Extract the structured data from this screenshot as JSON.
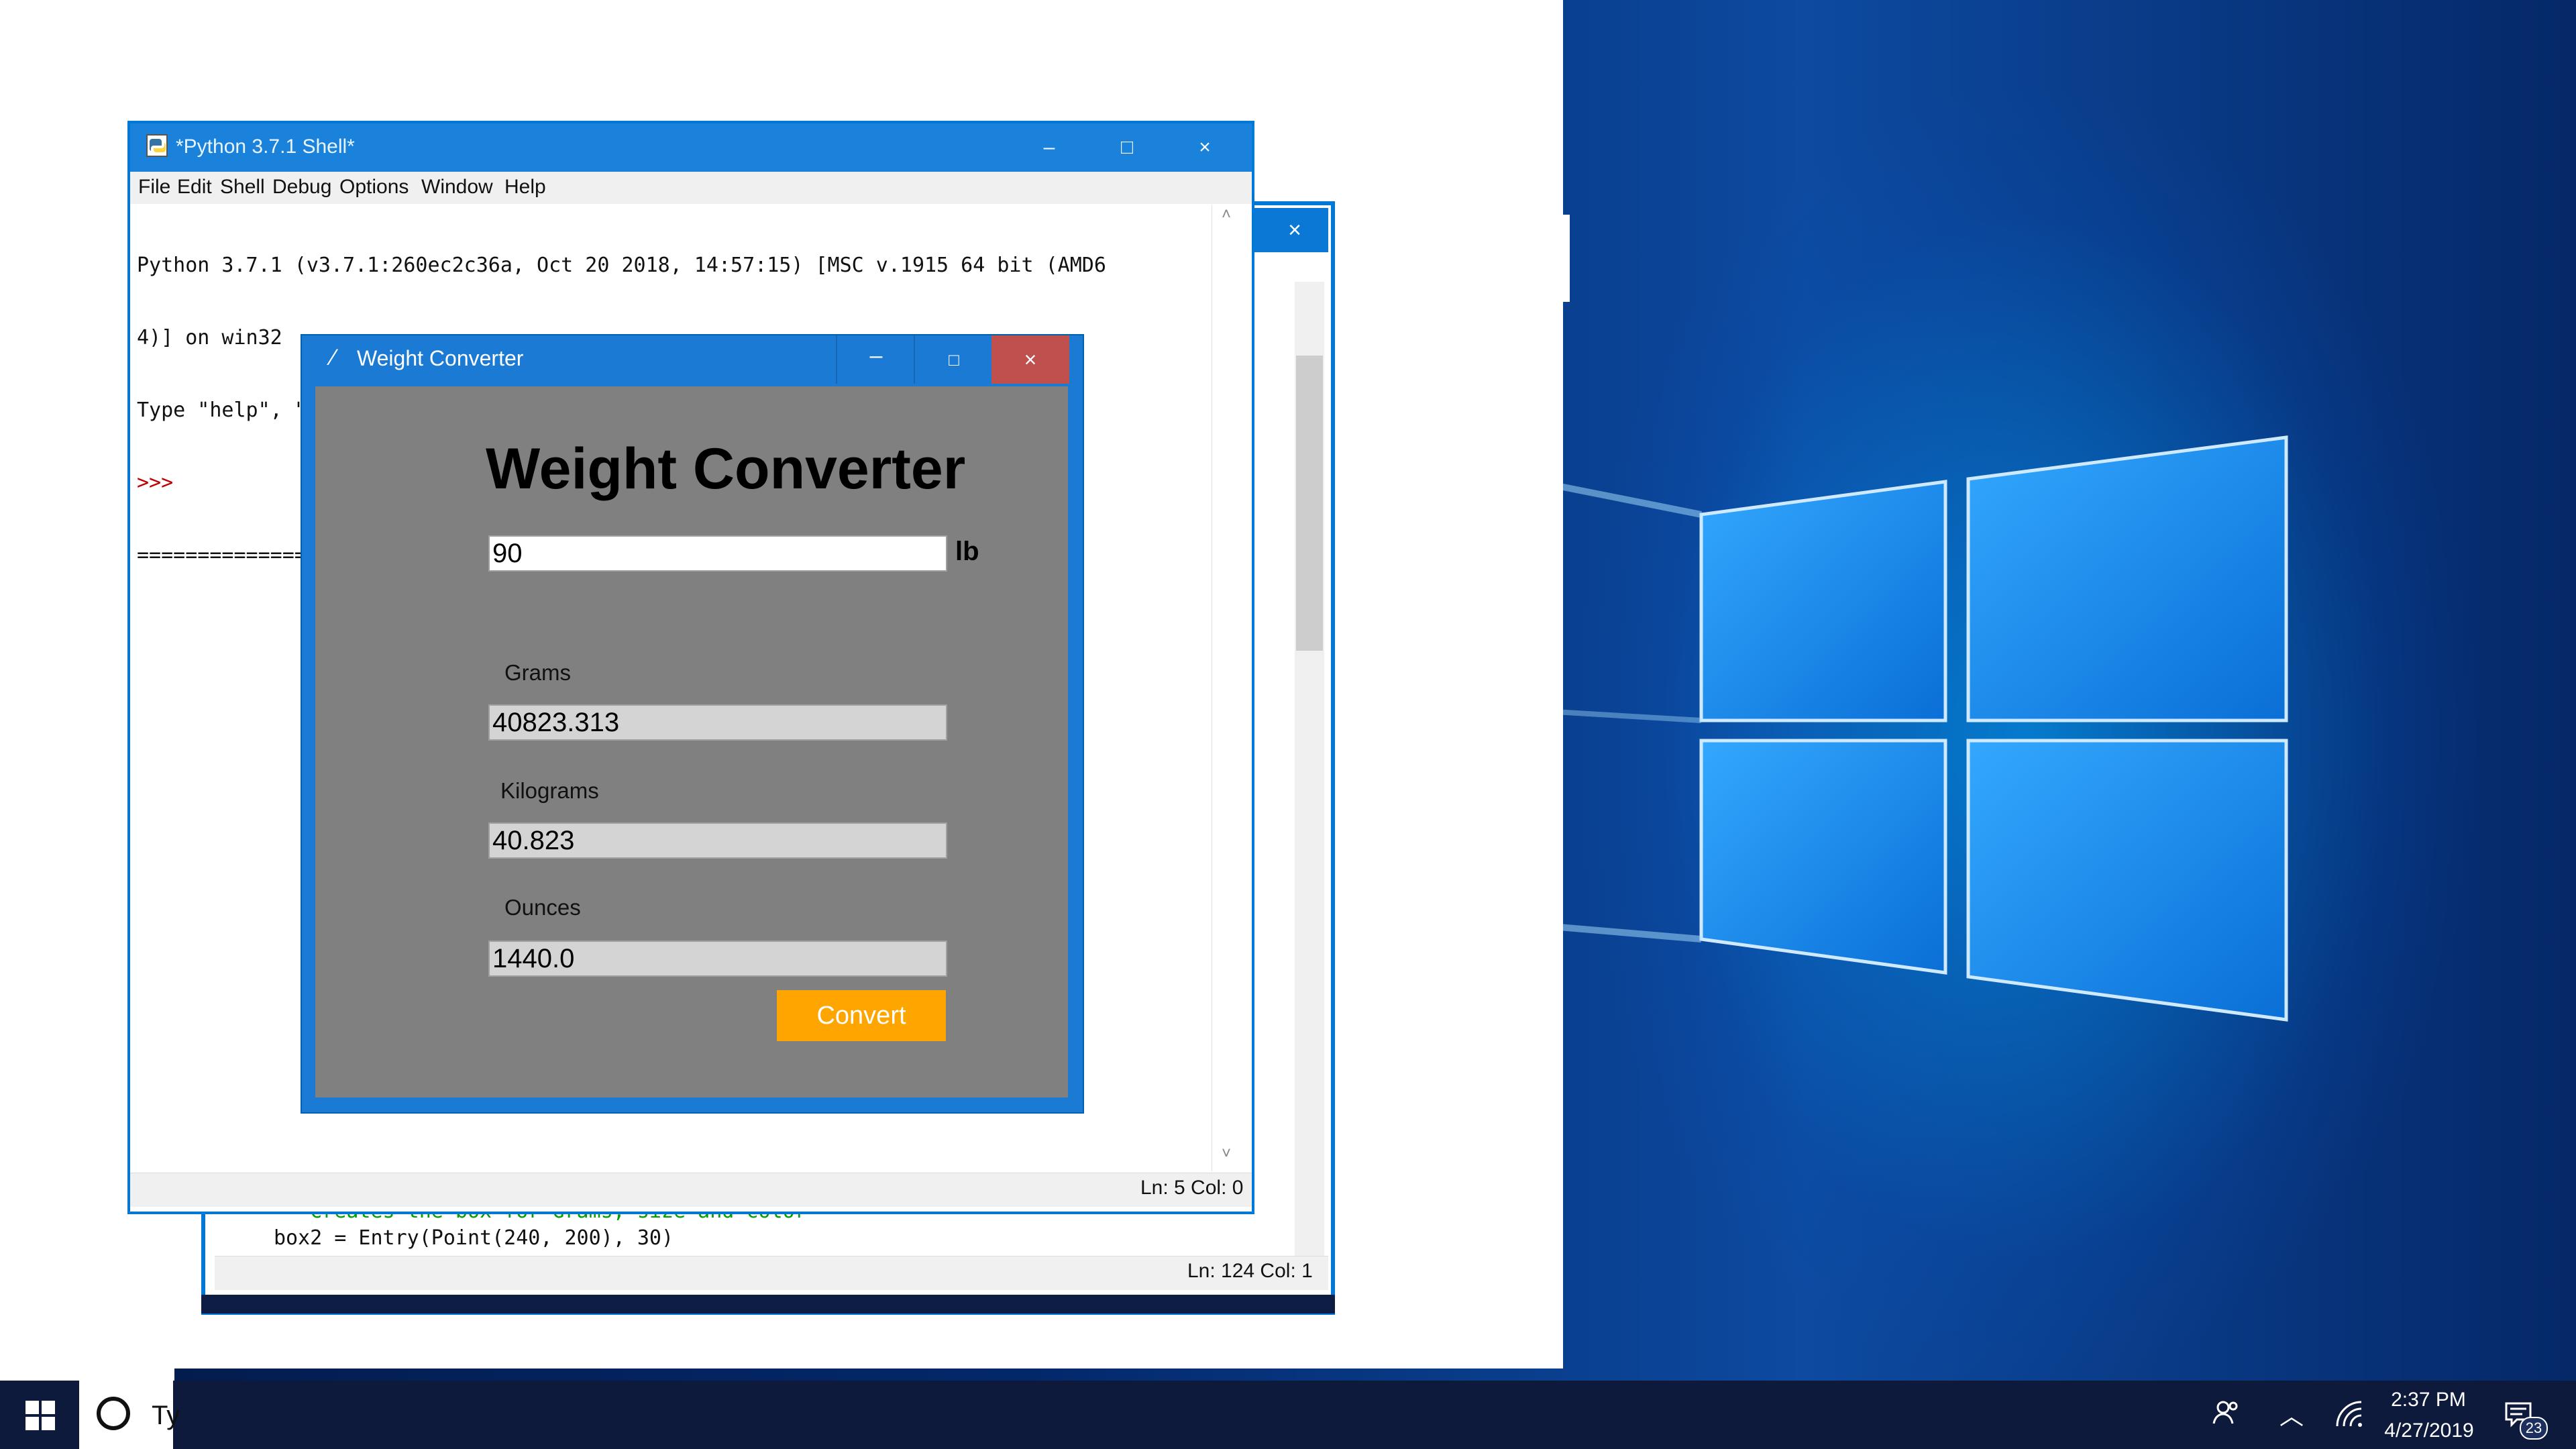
{
  "shell": {
    "title": "*Python 3.7.1 Shell*",
    "menu": [
      "File",
      "Edit",
      "Shell",
      "Debug",
      "Options",
      "Window",
      "Help"
    ],
    "lines": [
      "Python 3.7.1 (v3.7.1:260ec2c36a, Oct 20 2018, 14:57:15) [MSC v.1915 64 bit (AMD6",
      "4)] on win32",
      "Type \"help\", \"copyright\", \"credits\" or \"license()\" for more information."
    ],
    "prompt": ">>>",
    "restart_line": "============== RESTART: C:/Users/tanya/Desktop/wconverter.py ==============",
    "status": "Ln: 5  Col: 0",
    "buttons": {
      "minimize": "–",
      "maximize": "□",
      "close": "×"
    }
  },
  "editor": {
    "close": "×",
    "code_line1": "'''Creates the box for Grams, size and color'''",
    "code_line2": "box2 = Entry(Point(240, 200), 30)",
    "status": "Ln: 124  Col: 1"
  },
  "converter": {
    "title": "Weight Converter",
    "heading": "Weight Converter",
    "input_value": "90",
    "unit": "lb",
    "grams_label": "Grams",
    "grams_value": "40823.313",
    "kilograms_label": "Kilograms",
    "kilograms_value": "40.823",
    "ounces_label": "Ounces",
    "ounces_value": "1440.0",
    "convert_label": "Convert",
    "buttons": {
      "minimize": "–",
      "maximize": "□",
      "close": "×"
    }
  },
  "taskbar": {
    "search_text": "Ty",
    "time": "2:37 PM",
    "date": "4/27/2019",
    "notification_count": "23",
    "icons": [
      "windows-start-icon",
      "cortana-icon",
      "people-icon",
      "chevron-up-icon",
      "wifi-icon",
      "notification-icon"
    ]
  },
  "colors": {
    "titlebar_blue": "#1a82da",
    "converter_bg": "#808080",
    "convert_button": "#ffa500",
    "close_red": "#c0504d",
    "taskbar": "#0e1a3c"
  }
}
